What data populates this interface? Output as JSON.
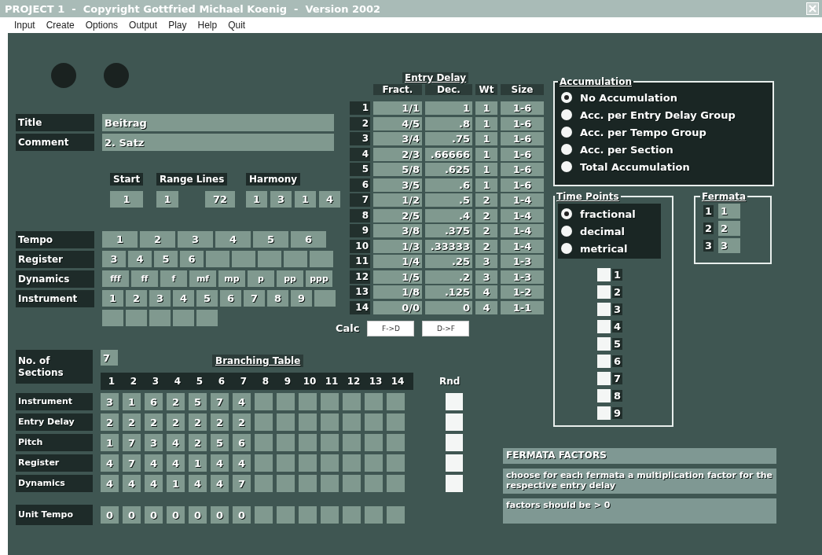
{
  "window": {
    "title": "PROJECT 1  -  Copyright Gottfried Michael Koenig  -  Version 2002"
  },
  "menu": [
    "Input",
    "Create",
    "Options",
    "Output",
    "Play",
    "Help",
    "Quit"
  ],
  "fields": [
    {
      "label": "Title",
      "value": "Beitrag"
    },
    {
      "label": "Comment",
      "value": "2. Satz"
    }
  ],
  "start": {
    "label": "Start",
    "value": "1"
  },
  "range_lines": {
    "label": "Range Lines",
    "values": [
      "1",
      "72"
    ]
  },
  "harmony": {
    "label": "Harmony",
    "values": [
      "1",
      "3",
      "1",
      "4"
    ]
  },
  "params": [
    {
      "label": "Tempo",
      "cells": [
        "1",
        "2",
        "3",
        "4",
        "5",
        "6"
      ]
    },
    {
      "label": "Register",
      "cells": [
        "3",
        "4",
        "5",
        "6"
      ]
    },
    {
      "label": "Dynamics",
      "cells": [
        "fff",
        "ff",
        "f",
        "mf",
        "mp",
        "p",
        "pp",
        "ppp"
      ]
    },
    {
      "label": "Instrument",
      "cells": [
        "1",
        "2",
        "3",
        "4",
        "5",
        "6",
        "7",
        "8",
        "9"
      ]
    }
  ],
  "entry_delay": {
    "title": "Entry Delay",
    "columns": [
      "Fract.",
      "Dec.",
      "Wt",
      "Size"
    ],
    "rows": [
      {
        "index": "1",
        "fract": "1/1",
        "dec": "1",
        "wt": "1",
        "size": "1-6"
      },
      {
        "index": "2",
        "fract": "4/5",
        "dec": ".8",
        "wt": "1",
        "size": "1-6"
      },
      {
        "index": "3",
        "fract": "3/4",
        "dec": ".75",
        "wt": "1",
        "size": "1-6"
      },
      {
        "index": "4",
        "fract": "2/3",
        "dec": ".66666",
        "wt": "1",
        "size": "1-6"
      },
      {
        "index": "5",
        "fract": "5/8",
        "dec": ".625",
        "wt": "1",
        "size": "1-6"
      },
      {
        "index": "6",
        "fract": "3/5",
        "dec": ".6",
        "wt": "1",
        "size": "1-6"
      },
      {
        "index": "7",
        "fract": "1/2",
        "dec": ".5",
        "wt": "2",
        "size": "1-4"
      },
      {
        "index": "8",
        "fract": "2/5",
        "dec": ".4",
        "wt": "2",
        "size": "1-4"
      },
      {
        "index": "9",
        "fract": "3/8",
        "dec": ".375",
        "wt": "2",
        "size": "1-4"
      },
      {
        "index": "10",
        "fract": "1/3",
        "dec": ".33333",
        "wt": "2",
        "size": "1-4"
      },
      {
        "index": "11",
        "fract": "1/4",
        "dec": ".25",
        "wt": "3",
        "size": "1-3"
      },
      {
        "index": "12",
        "fract": "1/5",
        "dec": ".2",
        "wt": "3",
        "size": "1-3"
      },
      {
        "index": "13",
        "fract": "1/8",
        "dec": ".125",
        "wt": "4",
        "size": "1-2"
      },
      {
        "index": "14",
        "fract": "0/0",
        "dec": "0",
        "wt": "4",
        "size": "1-1"
      }
    ],
    "calc": {
      "label": "Calc",
      "buttons": [
        "F->D",
        "D->F"
      ]
    }
  },
  "accumulation": {
    "title": "Accumulation",
    "options": [
      {
        "label": "No Accumulation",
        "selected": true
      },
      {
        "label": "Acc. per Entry Delay Group",
        "selected": false
      },
      {
        "label": "Acc. per Tempo Group",
        "selected": false
      },
      {
        "label": "Acc. per Section",
        "selected": false
      },
      {
        "label": "Total Accumulation",
        "selected": false
      }
    ]
  },
  "time_points": {
    "title": "Time Points",
    "options": [
      {
        "label": "fractional",
        "selected": true
      },
      {
        "label": "decimal",
        "selected": false
      },
      {
        "label": "metrical",
        "selected": false
      }
    ],
    "checkboxes": [
      {
        "label": "1",
        "checked": false
      },
      {
        "label": "2",
        "checked": false
      },
      {
        "label": "3",
        "checked": false
      },
      {
        "label": "4",
        "checked": false
      },
      {
        "label": "5",
        "checked": false
      },
      {
        "label": "6",
        "checked": false
      },
      {
        "label": "7",
        "checked": false
      },
      {
        "label": "8",
        "checked": false
      },
      {
        "label": "9",
        "checked": false
      }
    ]
  },
  "fermata": {
    "title": "Fermata",
    "rows": [
      {
        "index": "1",
        "value": "1"
      },
      {
        "index": "2",
        "value": "2"
      },
      {
        "index": "3",
        "value": "3"
      }
    ]
  },
  "sections": {
    "label": "No. of Sections",
    "value": "7"
  },
  "branching": {
    "title": "Branching Table",
    "columns": [
      "1",
      "2",
      "3",
      "4",
      "5",
      "6",
      "7",
      "8",
      "9",
      "10",
      "11",
      "12",
      "13",
      "14"
    ],
    "rnd_label": "Rnd",
    "rows": [
      {
        "label": "Instrument",
        "values": [
          "3",
          "1",
          "6",
          "2",
          "5",
          "7",
          "4"
        ],
        "rnd": false
      },
      {
        "label": "Entry Delay",
        "values": [
          "2",
          "2",
          "2",
          "2",
          "2",
          "2",
          "2"
        ],
        "rnd": false
      },
      {
        "label": "Pitch",
        "values": [
          "1",
          "7",
          "3",
          "4",
          "2",
          "5",
          "6"
        ],
        "rnd": false
      },
      {
        "label": "Register",
        "values": [
          "4",
          "7",
          "4",
          "4",
          "1",
          "4",
          "4"
        ],
        "rnd": false
      },
      {
        "label": "Dynamics",
        "values": [
          "4",
          "4",
          "4",
          "1",
          "4",
          "4",
          "7"
        ],
        "rnd": false
      }
    ],
    "unit_tempo": {
      "label": "Unit Tempo",
      "values": [
        "0",
        "0",
        "0",
        "0",
        "0",
        "0",
        "0"
      ]
    }
  },
  "factors": {
    "title": "FERMATA FACTORS",
    "description": "choose for each fermata a multiplication factor for the respective entry delay",
    "note": "factors should be > 0"
  }
}
